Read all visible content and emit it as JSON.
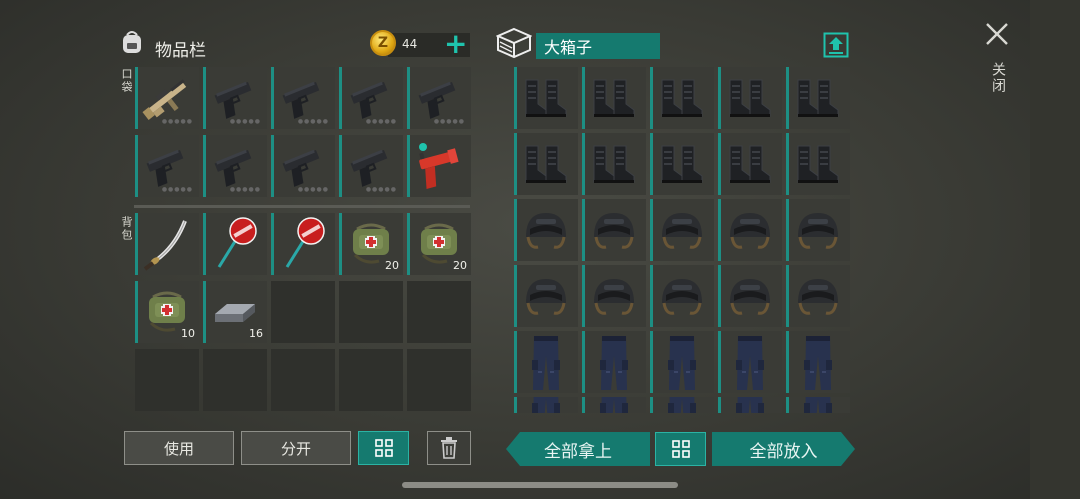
{
  "inventory": {
    "title": "物品栏",
    "coins": {
      "symbol": "Z",
      "amount": "44",
      "add_label": "+"
    },
    "pocket_label": "口袋",
    "backpack_label": "背包",
    "pocket_slots": [
      {
        "item": "assault-rifle",
        "qty": ""
      },
      {
        "item": "pistol",
        "qty": ""
      },
      {
        "item": "pistol",
        "qty": ""
      },
      {
        "item": "pistol",
        "qty": ""
      },
      {
        "item": "pistol",
        "qty": ""
      },
      {
        "item": "pistol",
        "qty": ""
      },
      {
        "item": "pistol",
        "qty": ""
      },
      {
        "item": "pistol",
        "qty": ""
      },
      {
        "item": "pistol",
        "qty": ""
      },
      {
        "item": "flare-gun",
        "qty": ""
      }
    ],
    "backpack_slots": [
      {
        "item": "katana",
        "qty": ""
      },
      {
        "item": "stop-sign-axe",
        "qty": ""
      },
      {
        "item": "stop-sign-axe",
        "qty": ""
      },
      {
        "item": "medkit-bag",
        "qty": "20"
      },
      {
        "item": "medkit-bag",
        "qty": "20"
      },
      {
        "item": "medkit-bag",
        "qty": "10"
      },
      {
        "item": "iron-ingot",
        "qty": "16"
      },
      {
        "item": "",
        "qty": ""
      },
      {
        "item": "",
        "qty": ""
      },
      {
        "item": "",
        "qty": ""
      },
      {
        "item": "",
        "qty": ""
      },
      {
        "item": "",
        "qty": ""
      },
      {
        "item": "",
        "qty": ""
      },
      {
        "item": "",
        "qty": ""
      },
      {
        "item": "",
        "qty": ""
      }
    ],
    "buttons": {
      "use": "使用",
      "split": "分开"
    }
  },
  "container": {
    "name": "大箱子",
    "rows": [
      [
        "boots",
        "boots",
        "boots",
        "boots",
        "boots"
      ],
      [
        "boots",
        "boots",
        "boots",
        "boots",
        "boots"
      ],
      [
        "helmet",
        "helmet",
        "helmet",
        "helmet",
        "helmet"
      ],
      [
        "helmet",
        "helmet",
        "helmet",
        "helmet",
        "helmet"
      ],
      [
        "pants",
        "pants",
        "pants",
        "pants",
        "pants"
      ],
      [
        "pants",
        "pants",
        "pants",
        "pants",
        "pants"
      ]
    ],
    "take_all": "全部拿上",
    "put_all": "全部放入"
  },
  "close": {
    "label": "关闭"
  },
  "colors": {
    "accent": "#157a6f",
    "accent_light": "#1fc3ad",
    "slot_bg": "#2f302c"
  }
}
